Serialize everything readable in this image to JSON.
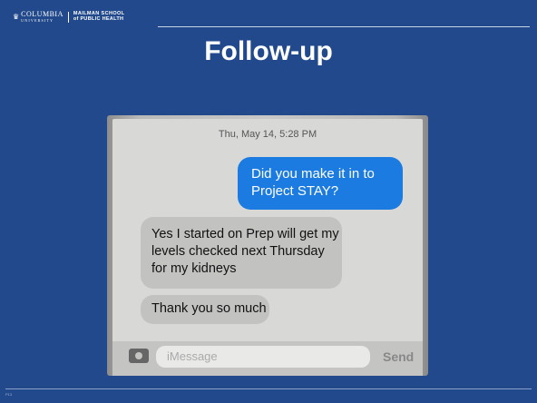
{
  "header": {
    "logo_left_top": "COLUMBIA",
    "logo_left_bottom": "UNIVERSITY",
    "logo_right_top": "MAILMAN SCHOOL",
    "logo_right_bottom": "of PUBLIC HEALTH"
  },
  "slide": {
    "title": "Follow-up"
  },
  "phone": {
    "timestamp": "Thu, May 14, 5:28 PM",
    "messages": [
      {
        "direction": "outgoing",
        "text": "Did you make it in to Project STAY?"
      },
      {
        "direction": "incoming",
        "text": "Yes I started on Prep will get my levels checked next Thursday for my kidneys"
      },
      {
        "direction": "incoming",
        "text": "Thank you so much"
      }
    ],
    "input_placeholder": "iMessage",
    "send_label": "Send"
  },
  "footer": {
    "page_label": "P13"
  },
  "colors": {
    "slide_background": "#21498b",
    "outgoing_bubble": "#1b7be0",
    "incoming_bubble": "#c2c3c1"
  }
}
